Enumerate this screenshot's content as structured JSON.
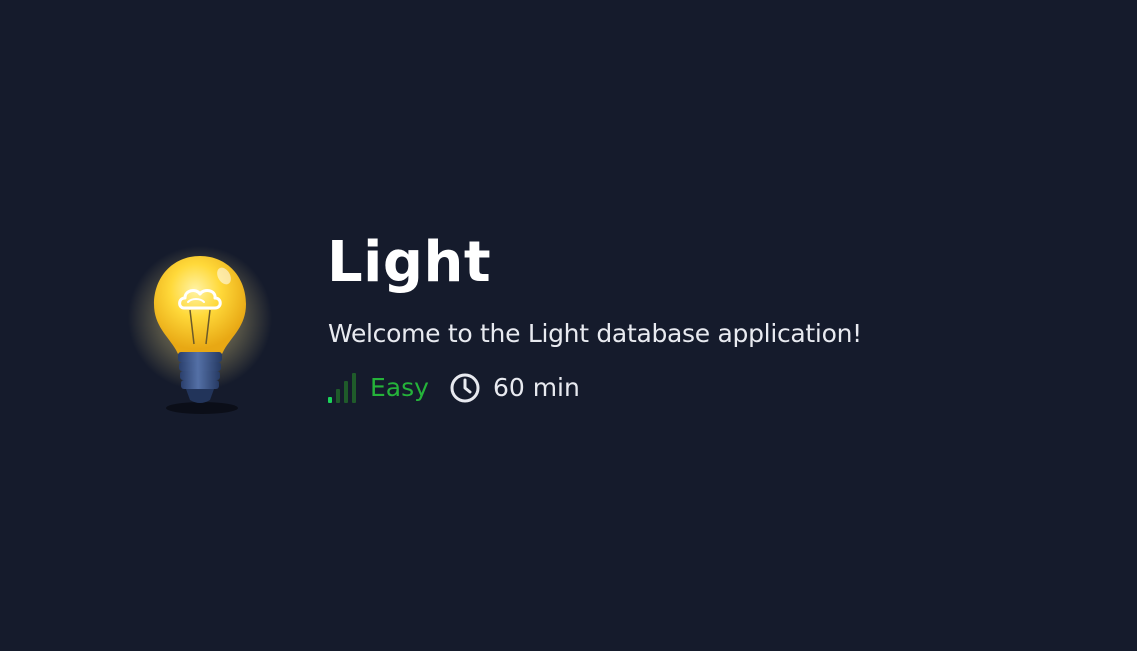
{
  "room": {
    "title": "Light",
    "description": "Welcome to the Light database application!",
    "difficulty": "Easy",
    "difficulty_level": 1,
    "difficulty_levels_total": 4,
    "duration": "60 min",
    "icon": "lightbulb-icon"
  },
  "colors": {
    "background": "#151b2c",
    "difficulty_easy": "#25b33a",
    "text_primary": "#ffffff",
    "text_secondary": "#e8eaf0"
  }
}
